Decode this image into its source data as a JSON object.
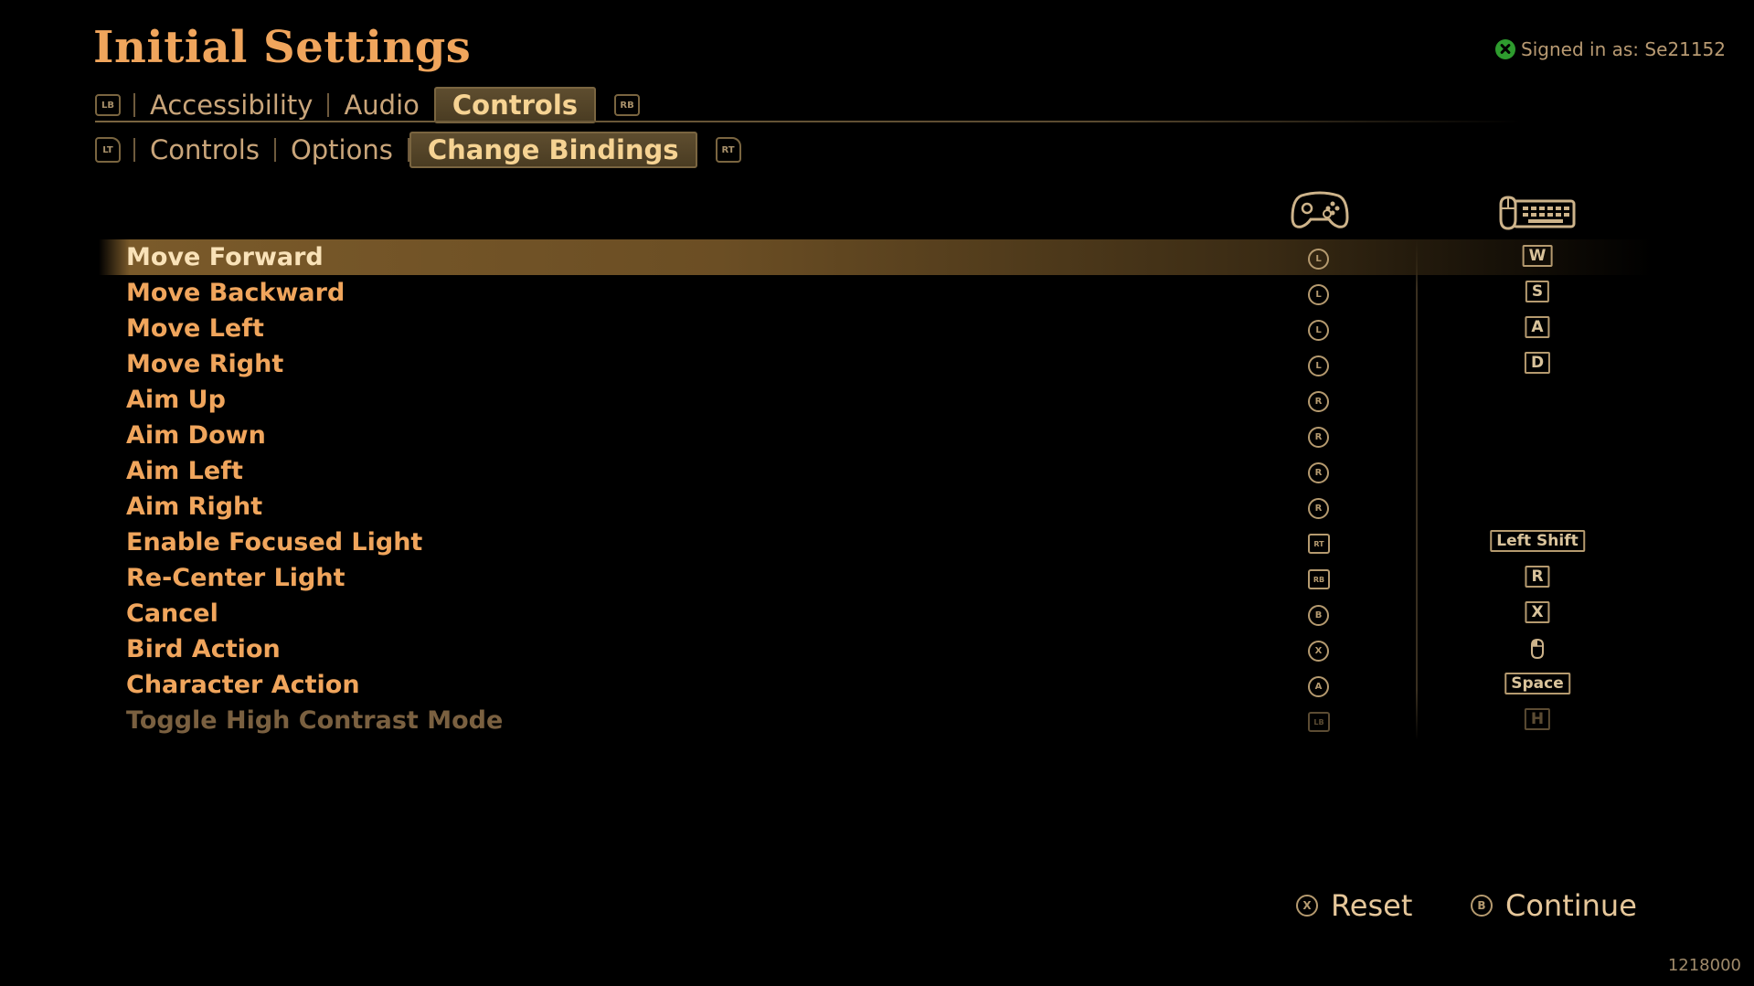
{
  "title": "Initial Settings",
  "signin": "Signed in as: Se21152",
  "main_tabs": {
    "left_button": "LB",
    "right_button": "RB",
    "items": [
      "Accessibility",
      "Audio",
      "Controls"
    ],
    "active": "Controls"
  },
  "sub_tabs": {
    "left_button": "LT",
    "right_button": "RT",
    "items": [
      "Controls",
      "Options",
      "Change Bindings"
    ],
    "active": "Change Bindings"
  },
  "columns": {
    "gamepad": "gamepad-icon",
    "keyboard_mouse": "mouse-keyboard-icon"
  },
  "bindings": [
    {
      "action": "Move Forward",
      "pad": "L",
      "pad_dir": "up",
      "key": "W",
      "selected": true
    },
    {
      "action": "Move Backward",
      "pad": "L",
      "pad_dir": "down",
      "key": "S"
    },
    {
      "action": "Move Left",
      "pad": "L",
      "pad_dir": "left",
      "key": "A"
    },
    {
      "action": "Move Right",
      "pad": "L",
      "pad_dir": "right",
      "key": "D"
    },
    {
      "action": "Aim Up",
      "pad": "R",
      "pad_dir": "up",
      "key": ""
    },
    {
      "action": "Aim Down",
      "pad": "R",
      "pad_dir": "down",
      "key": ""
    },
    {
      "action": "Aim Left",
      "pad": "R",
      "pad_dir": "left",
      "key": ""
    },
    {
      "action": "Aim Right",
      "pad": "R",
      "pad_dir": "right",
      "key": ""
    },
    {
      "action": "Enable Focused Light",
      "pad": "RT",
      "key": "Left Shift"
    },
    {
      "action": "Re-Center Light",
      "pad": "RB",
      "key": "R"
    },
    {
      "action": "Cancel",
      "pad": "B",
      "key": "X"
    },
    {
      "action": "Bird Action",
      "pad": "X",
      "key": "mouse-click-icon"
    },
    {
      "action": "Character Action",
      "pad": "A",
      "key": "Space"
    },
    {
      "action": "Toggle High Contrast Mode",
      "pad": "LB",
      "key": "H",
      "disabled": true
    }
  ],
  "footer": {
    "reset_button": "X",
    "reset_label": "Reset",
    "continue_button": "B",
    "continue_label": "Continue"
  },
  "version": "1218000",
  "colors": {
    "accent": "#f0a55c",
    "selected_row": "#6b4e24",
    "xbox_green": "#2e9c2e"
  }
}
